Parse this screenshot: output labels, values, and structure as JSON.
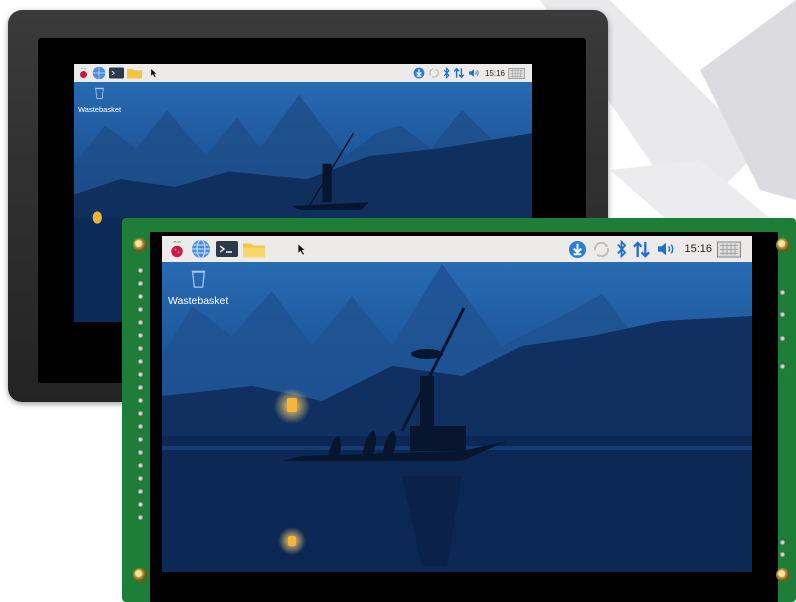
{
  "front_screen": {
    "taskbar": {
      "icons": [
        "raspberry-icon",
        "globe-icon",
        "terminal-icon",
        "folder-icon"
      ],
      "tray_icons": [
        "download-icon",
        "sync-icon",
        "bluetooth-icon",
        "network-arrows-icon",
        "volume-icon",
        "keyboard-icon"
      ],
      "clock": "15:16"
    },
    "desktop": {
      "wastebasket_label": "Wastebasket"
    }
  },
  "back_screen": {
    "taskbar": {
      "icons": [
        "raspberry-icon",
        "globe-icon",
        "terminal-icon",
        "folder-icon"
      ],
      "tray_icons": [
        "download-icon",
        "sync-icon",
        "bluetooth-icon",
        "network-arrows-icon",
        "volume-icon",
        "keyboard-icon"
      ],
      "clock": "15:16"
    },
    "desktop": {
      "wastebasket_label": "Wastebasket"
    }
  },
  "colors": {
    "taskbar_bg": "#ecebe9",
    "pcb_green": "#1e7d36",
    "accent_blue": "#2a7fd4",
    "bluetooth_blue": "#1d6fd0"
  }
}
